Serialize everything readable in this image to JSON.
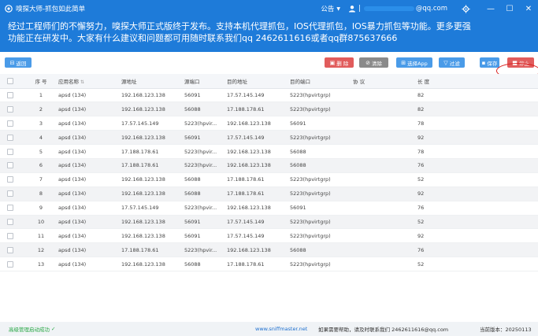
{
  "window": {
    "title": "嗅探大师-抓包如此简单",
    "notice": "公告",
    "user_email_suffix": "@qq.com",
    "minimize": "—",
    "maximize": "☐",
    "close": "✕"
  },
  "banner": {
    "line1": "经过工程师们的不懈努力，嗅探大师正式版终于发布。支持本机代理抓包，IOS代理抓包，IOS暴力抓包等功能。更多更强",
    "line2": "功能正在研发中。大家有什么建议和问题都可用随时联系我们qq 2462611616或者qq群875637666"
  },
  "toolbar": {
    "back": "返回",
    "delete": "删 除",
    "clear": "清除",
    "select_app": "选择App",
    "filter": "过滤",
    "save": "保存",
    "stop": "停止"
  },
  "table": {
    "headers": {
      "index": "序 号",
      "app_name": "应用名称",
      "src_addr": "源地址",
      "src_port": "源端口",
      "dst_addr": "目的地址",
      "dst_port": "目的端口",
      "protocol": "协 议",
      "length": "长 度"
    },
    "rows": [
      {
        "index": "1",
        "app": "apsd (134)",
        "src": "192.168.123.138",
        "sport": "56091",
        "dst": "17.57.145.149",
        "dport": "5223(hpvirtgrp)",
        "proto": "",
        "len": "82"
      },
      {
        "index": "2",
        "app": "apsd (134)",
        "src": "192.168.123.138",
        "sport": "56088",
        "dst": "17.188.178.61",
        "dport": "5223(hpvirtgrp)",
        "proto": "",
        "len": "82"
      },
      {
        "index": "3",
        "app": "apsd (134)",
        "src": "17.57.145.149",
        "sport": "5223(hpvir...",
        "dst": "192.168.123.138",
        "dport": "56091",
        "proto": "",
        "len": "78"
      },
      {
        "index": "4",
        "app": "apsd (134)",
        "src": "192.168.123.138",
        "sport": "56091",
        "dst": "17.57.145.149",
        "dport": "5223(hpvirtgrp)",
        "proto": "",
        "len": "92"
      },
      {
        "index": "5",
        "app": "apsd (134)",
        "src": "17.188.178.61",
        "sport": "5223(hpvir...",
        "dst": "192.168.123.138",
        "dport": "56088",
        "proto": "",
        "len": "78"
      },
      {
        "index": "6",
        "app": "apsd (134)",
        "src": "17.188.178.61",
        "sport": "5223(hpvir...",
        "dst": "192.168.123.138",
        "dport": "56088",
        "proto": "",
        "len": "76"
      },
      {
        "index": "7",
        "app": "apsd (134)",
        "src": "192.168.123.138",
        "sport": "56088",
        "dst": "17.188.178.61",
        "dport": "5223(hpvirtgrp)",
        "proto": "",
        "len": "52"
      },
      {
        "index": "8",
        "app": "apsd (134)",
        "src": "192.168.123.138",
        "sport": "56088",
        "dst": "17.188.178.61",
        "dport": "5223(hpvirtgrp)",
        "proto": "",
        "len": "92"
      },
      {
        "index": "9",
        "app": "apsd (134)",
        "src": "17.57.145.149",
        "sport": "5223(hpvir...",
        "dst": "192.168.123.138",
        "dport": "56091",
        "proto": "",
        "len": "76"
      },
      {
        "index": "10",
        "app": "apsd (134)",
        "src": "192.168.123.138",
        "sport": "56091",
        "dst": "17.57.145.149",
        "dport": "5223(hpvirtgrp)",
        "proto": "",
        "len": "52"
      },
      {
        "index": "11",
        "app": "apsd (134)",
        "src": "192.168.123.138",
        "sport": "56091",
        "dst": "17.57.145.149",
        "dport": "5223(hpvirtgrp)",
        "proto": "",
        "len": "92"
      },
      {
        "index": "12",
        "app": "apsd (134)",
        "src": "17.188.178.61",
        "sport": "5223(hpvir...",
        "dst": "192.168.123.138",
        "dport": "56088",
        "proto": "",
        "len": "76"
      },
      {
        "index": "13",
        "app": "apsd (134)",
        "src": "192.168.123.138",
        "sport": "56088",
        "dst": "17.188.178.61",
        "dport": "5223(hpvirtgrp)",
        "proto": "",
        "len": "52"
      }
    ]
  },
  "status": {
    "left": "高级管理启动成功",
    "site": "www.sniffmaster.net",
    "help": "如果需要帮助，请及时联系我们 2462611616@qq.com",
    "version": "当前版本：20250113"
  },
  "colors": {
    "primary": "#1e7bd9",
    "danger": "#e15c5c",
    "neutral": "#8a8a8a",
    "success": "#28a745"
  }
}
